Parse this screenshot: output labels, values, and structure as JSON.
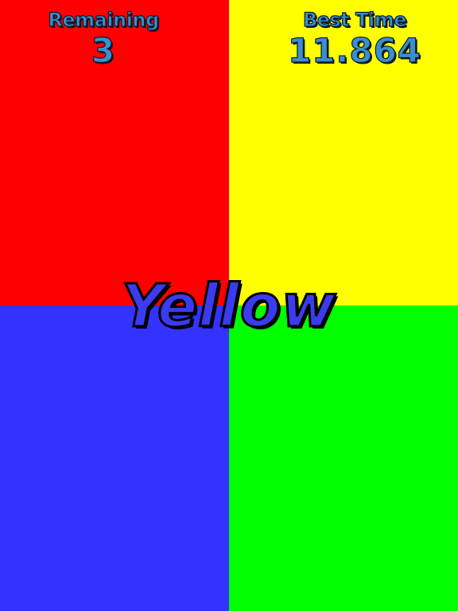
{
  "colors": {
    "red": "#ff0000",
    "yellow": "#ffff00",
    "blue": "#3333ff",
    "green": "#00ff00",
    "hud_text": "#3a8fd0",
    "word_fill": "#3b3bf0"
  },
  "hud": {
    "remaining_label": "Remaining",
    "remaining_value": "3",
    "best_time_label": "Best Time",
    "best_time_value": "11.864"
  },
  "prompt": {
    "word": "Yellow"
  }
}
